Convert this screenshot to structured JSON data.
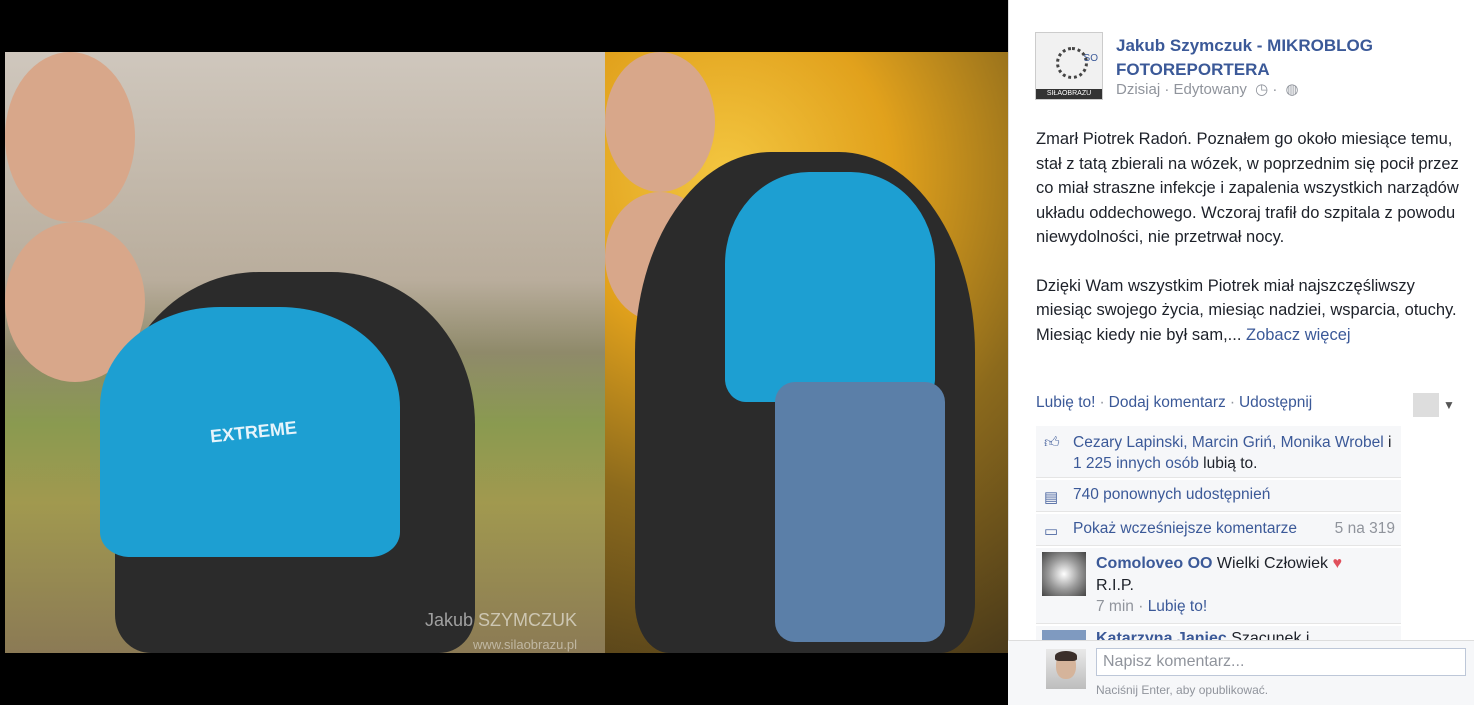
{
  "photo": {
    "watermark": "Jakub SZYMCZUK",
    "watermark_url": "www.silaobrazu.pl",
    "shirt_text": "EXTREME"
  },
  "post": {
    "avatar_label": "SIŁAOBRAZU",
    "avatar_mark": "SO",
    "author": "Jakub Szymczuk - MIKROBLOG FOTOREPORTERA",
    "date": "Dzisiaj",
    "edited": "Edytowany",
    "paragraph1": "Zmarł Piotrek Radoń. Poznałem go około miesiące temu, stał z tatą zbierali na wózek, w poprzednim się pocił przez co miał straszne infekcje i zapalenia wszystkich narządów układu oddechowego. Wczoraj trafił do szpitala z powodu niewydolności, nie przetrwał nocy.",
    "paragraph2": "Dzięki Wam wszystkim Piotrek miał najszczęśliwszy miesiąc swojego życia, miesiąc nadziei, wsparcia, otuchy. Miesiąc kiedy nie był sam,...",
    "see_more": "Zobacz więcej"
  },
  "actions": {
    "like": "Lubię to!",
    "comment": "Dodaj komentarz",
    "share": "Udostępnij"
  },
  "likes": {
    "names": "Cezary Lapinski, Marcin Griń, Monika Wrobel",
    "connector": "i",
    "others": "1 225 innych osób",
    "suffix": "lubią to."
  },
  "shares": {
    "text": "740 ponownych udostępnień"
  },
  "more_comments": {
    "label": "Pokaż wcześniejsze komentarze",
    "count": "5 na 319"
  },
  "comments": [
    {
      "author": "Comoloveo OO",
      "text": "Wielki Człowiek",
      "text2": "R.I.P.",
      "time": "7 min",
      "like": "Lubię to!"
    },
    {
      "author": "Katarzyna Janiec",
      "text": "Szacunek i"
    }
  ],
  "composer": {
    "placeholder": "Napisz komentarz...",
    "hint": "Naciśnij Enter, aby opublikować."
  }
}
